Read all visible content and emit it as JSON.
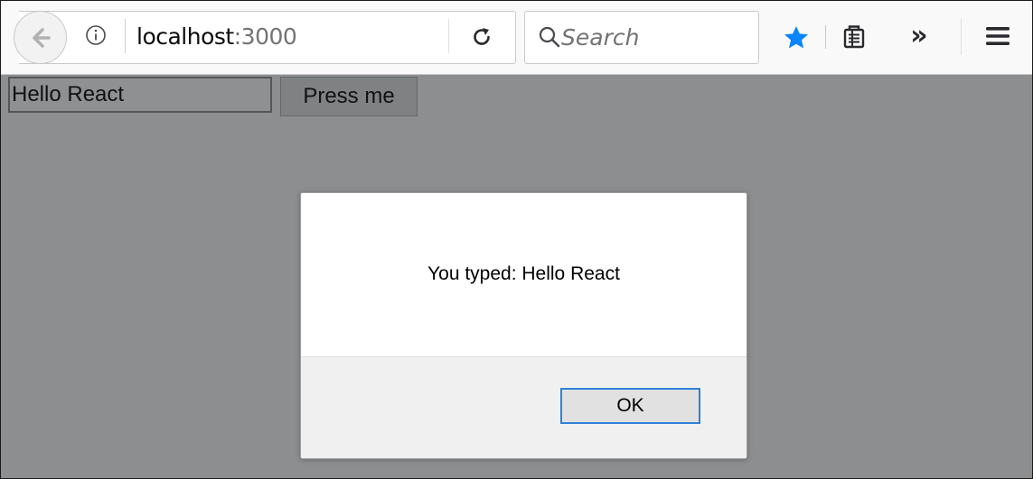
{
  "browser": {
    "url_host": "localhost",
    "url_port": ":3000",
    "search_placeholder": "Search"
  },
  "page": {
    "text_input_value": "Hello React",
    "press_button_label": "Press me"
  },
  "dialog": {
    "message": "You typed: Hello React",
    "ok_label": "OK"
  }
}
